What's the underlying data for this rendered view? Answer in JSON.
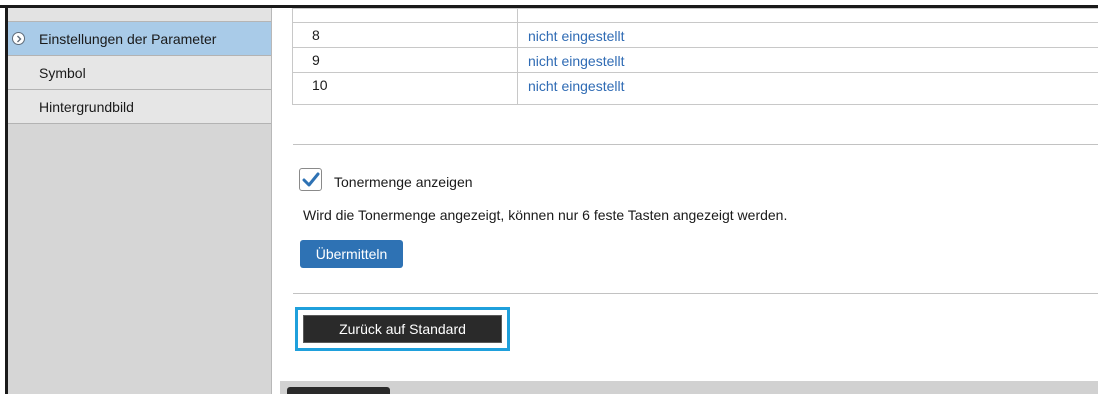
{
  "sidebar": {
    "items": [
      {
        "label": "Einstellungen der Parameter",
        "active": true
      },
      {
        "label": "Symbol",
        "active": false
      },
      {
        "label": "Hintergrundbild",
        "active": false
      }
    ]
  },
  "table": {
    "rows": [
      {
        "number": "8",
        "value": "nicht eingestellt"
      },
      {
        "number": "9",
        "value": "nicht eingestellt"
      },
      {
        "number": "10",
        "value": "nicht eingestellt"
      }
    ]
  },
  "toner": {
    "checkbox_label": "Tonermenge anzeigen",
    "checked": true,
    "note": "Wird die Tonermenge angezeigt, können nur 6 feste Tasten angezeigt werden.",
    "submit_label": "Übermitteln"
  },
  "reset": {
    "label": "Zurück auf Standard"
  },
  "colors": {
    "accent": "#2e72b4",
    "link": "#2f6bb4",
    "sidebar_active": "#a9cbe8",
    "highlight_outline": "#1fa0dc"
  }
}
